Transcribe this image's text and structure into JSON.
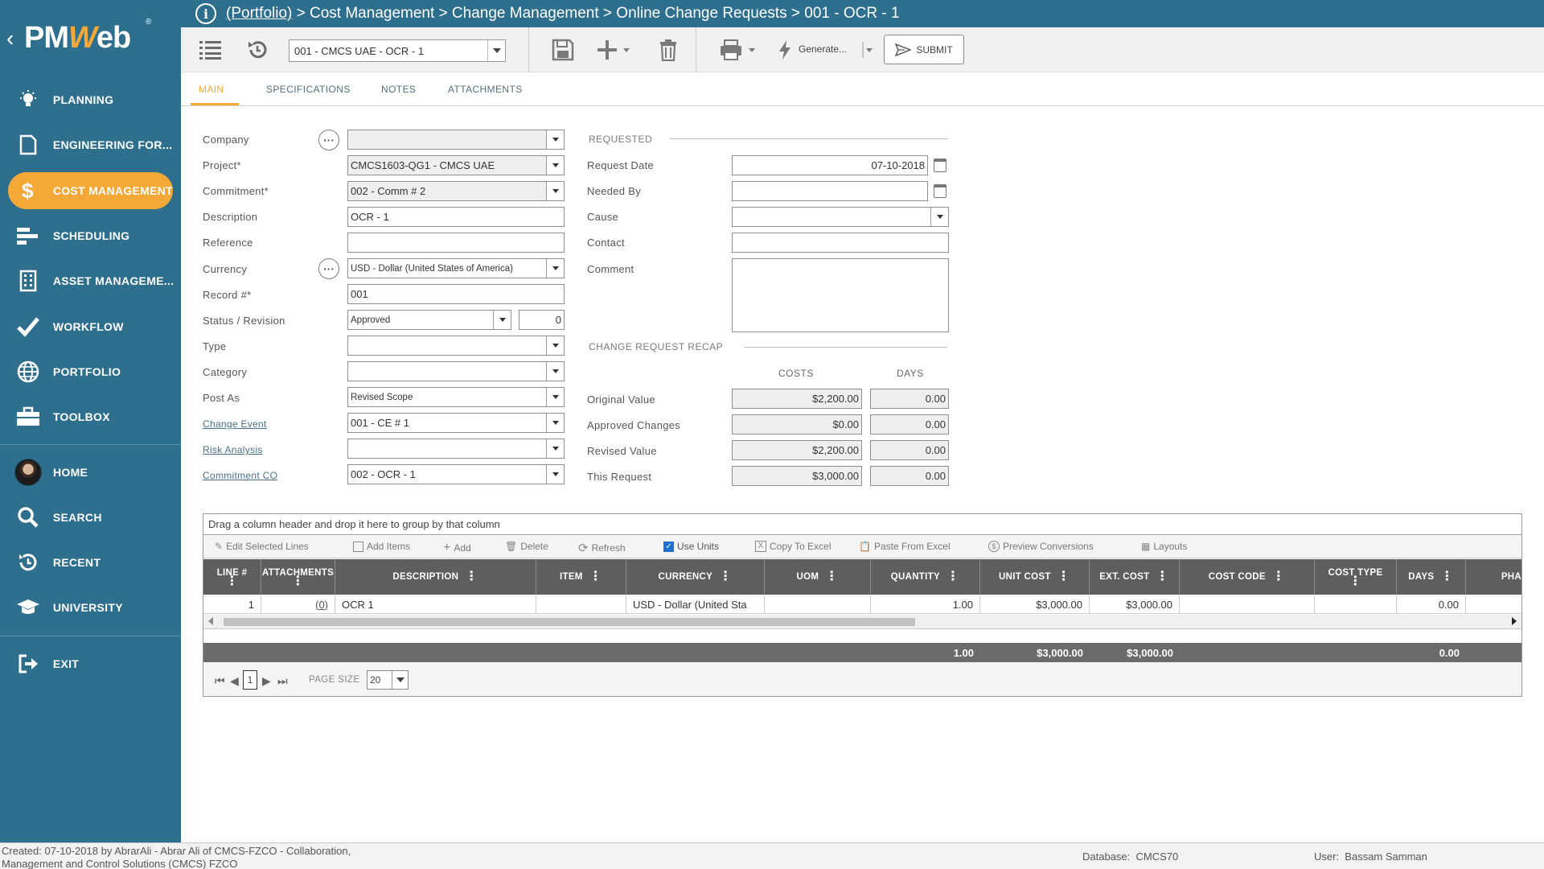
{
  "brand": {
    "logo_text_pre": "PM",
    "logo_text_w": "W",
    "logo_text_post": "eb",
    "registered": "®"
  },
  "nav": {
    "items": [
      {
        "label": "PLANNING",
        "icon": "bulb-icon"
      },
      {
        "label": "ENGINEERING FOR...",
        "icon": "document-icon"
      },
      {
        "label": "COST MANAGEMENT",
        "icon": "dollar-icon"
      },
      {
        "label": "SCHEDULING",
        "icon": "bars-icon"
      },
      {
        "label": "ASSET MANAGEME...",
        "icon": "building-icon"
      },
      {
        "label": "WORKFLOW",
        "icon": "checkmark-icon"
      },
      {
        "label": "PORTFOLIO",
        "icon": "globe-icon"
      },
      {
        "label": "TOOLBOX",
        "icon": "toolbox-icon"
      }
    ],
    "secondary": [
      {
        "label": "HOME",
        "icon": "avatar"
      },
      {
        "label": "SEARCH",
        "icon": "search-icon"
      },
      {
        "label": "RECENT",
        "icon": "history-icon"
      },
      {
        "label": "UNIVERSITY",
        "icon": "graduation-cap-icon"
      }
    ],
    "exit": {
      "label": "EXIT",
      "icon": "exit-icon"
    },
    "active_color": "#f4a838",
    "bg_color": "#2e6f8e"
  },
  "breadcrumb": {
    "info_glyph": "i",
    "portfolio": "(Portfolio)",
    "rest": " > Cost Management > Change Management > Online Change Requests > 001 - OCR - 1"
  },
  "toolbar": {
    "record_select": "001 - CMCS UAE - OCR - 1",
    "generate_label": "Generate...",
    "submit_label": "SUBMIT"
  },
  "tabs": [
    {
      "label": "MAIN",
      "active": true
    },
    {
      "label": "SPECIFICATIONS",
      "active": false
    },
    {
      "label": "NOTES",
      "active": false
    },
    {
      "label": "ATTACHMENTS",
      "active": false
    }
  ],
  "form": {
    "labels": {
      "company": "Company",
      "project": "Project*",
      "commitment": "Commitment*",
      "description": "Description",
      "reference": "Reference",
      "currency": "Currency",
      "record": "Record #*",
      "status_revision": "Status / Revision",
      "type": "Type",
      "category": "Category",
      "post_as": "Post As",
      "change_event": "Change Event",
      "risk_analysis": "Risk Analysis",
      "commitment_co": "Commitment CO"
    },
    "values": {
      "company": "",
      "project": "CMCS1603-QG1 - CMCS UAE",
      "commitment": "002 - Comm # 2",
      "description": "OCR - 1",
      "reference": "",
      "currency": "USD - Dollar (United States of America)",
      "record": "001",
      "status": "Approved",
      "revision": "0",
      "type": "",
      "category": "",
      "post_as": "Revised Scope",
      "change_event": "001 - CE # 1",
      "risk_analysis": "",
      "commitment_co": "002 - OCR - 1"
    }
  },
  "requested": {
    "section_title": "REQUESTED",
    "labels": {
      "request_date": "Request Date",
      "needed_by": "Needed By",
      "cause": "Cause",
      "contact": "Contact",
      "comment": "Comment"
    },
    "values": {
      "request_date": "07-10-2018",
      "needed_by": "",
      "cause": "",
      "contact": "",
      "comment": ""
    }
  },
  "recap": {
    "section_title": "CHANGE REQUEST RECAP",
    "col_costs": "COSTS",
    "col_days": "DAYS",
    "rows": [
      {
        "label": "Original Value",
        "cost": "$2,200.00",
        "days": "0.00"
      },
      {
        "label": "Approved Changes",
        "cost": "$0.00",
        "days": "0.00"
      },
      {
        "label": "Revised Value",
        "cost": "$2,200.00",
        "days": "0.00"
      },
      {
        "label": "This Request",
        "cost": "$3,000.00",
        "days": "0.00"
      }
    ]
  },
  "grid": {
    "group_hint": "Drag a column header and drop it here to group by that column",
    "toolbar": {
      "edit_selected": "Edit Selected Lines",
      "add_items": "Add Items",
      "add": "Add",
      "delete": "Delete",
      "refresh": "Refresh",
      "use_units": "Use Units",
      "use_units_checked": true,
      "copy_to_excel": "Copy To Excel",
      "paste_from_excel": "Paste From Excel",
      "preview_conversions": "Preview Conversions",
      "layouts": "Layouts"
    },
    "columns": {
      "line": "LINE #",
      "attachments": "ATTACHMENTS",
      "description": "DESCRIPTION",
      "item": "ITEM",
      "currency": "CURRENCY",
      "uom": "UOM",
      "quantity": "QUANTITY",
      "unit_cost": "UNIT COST",
      "ext_cost": "EXT. COST",
      "cost_code": "COST CODE",
      "cost_type": "COST TYPE",
      "days": "DAYS",
      "phase": "PHA"
    },
    "row": {
      "line": "1",
      "attachments": "(0)",
      "description": "OCR 1",
      "item": "",
      "currency": "USD - Dollar (United Sta",
      "uom": "",
      "quantity": "1.00",
      "unit_cost": "$3,000.00",
      "ext_cost": "$3,000.00",
      "cost_code": "",
      "cost_type": "",
      "days": "0.00"
    },
    "totals": {
      "quantity": "1.00",
      "unit_cost": "$3,000.00",
      "ext_cost": "$3,000.00",
      "days": "0.00"
    },
    "pager": {
      "current_page": "1",
      "page_size_label": "PAGE SIZE",
      "page_size": "20"
    }
  },
  "status_bar": {
    "created_line1": "Created:  07-10-2018 by AbrarAli - Abrar Ali of CMCS-FZCO - Collaboration,",
    "created_line2": "Management and Control Solutions (CMCS) FZCO",
    "database_label": "Database:",
    "database_value": "CMCS70",
    "user_label": "User:",
    "user_value": "Bassam Samman"
  }
}
